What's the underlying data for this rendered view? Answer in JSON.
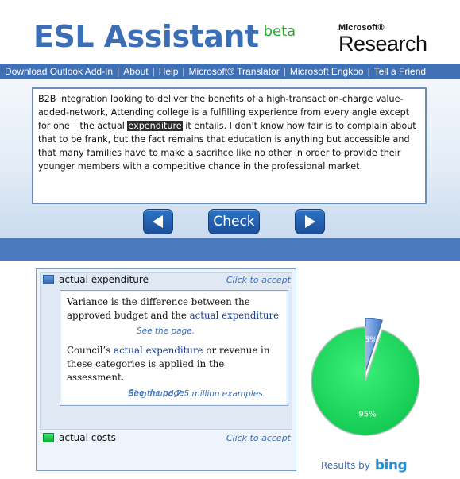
{
  "header": {
    "logo_main": "ESL Assistant",
    "logo_beta": "beta",
    "ms_small": "Microsoft®",
    "ms_big": "Research"
  },
  "nav": {
    "items": [
      "Download Outlook Add-In",
      "About",
      "Help",
      "Microsoft® Translator",
      "Microsoft Engkoo",
      "Tell a Friend"
    ],
    "separator": "|"
  },
  "editor": {
    "text_before": "B2B integration looking to deliver the benefits of a high-transaction-charge value-added-network, Attending college is a fulfilling experience from every angle except for one – the actual ",
    "highlighted": "expenditure",
    "text_after": " it entails. I don't know how fair is to complain about that to be frank, but the fact remains that education is anything but accessible and that many families have to make a sacrifice like no other in order to provide their younger members with a competitive chance in the professional market."
  },
  "controls": {
    "prev_icon": "left-arrow-icon",
    "check_label": "Check",
    "next_icon": "right-arrow-icon"
  },
  "suggestions": [
    {
      "label": "actual expenditure",
      "accept": "Click to accept",
      "color": "#2e64b0"
    },
    {
      "label": "actual costs",
      "accept": "Click to accept",
      "color": "#10b03a"
    }
  ],
  "examples": {
    "ex1_before": "Variance is the difference between the approved budget and the ",
    "ex1_link": "actual expenditure",
    "ex1_see": "See the page.",
    "ex2_before": "Council’s ",
    "ex2_link": "actual expenditure",
    "ex2_after": " or revenue in these categories is  applied in the assessment.",
    "ex2_see": "See the page.",
    "bing_found": "Bing found 7.5 million examples."
  },
  "chart_data": {
    "type": "pie",
    "categories": [
      "actual expenditure",
      "actual costs"
    ],
    "values": [
      5,
      95
    ],
    "labels": [
      "5%",
      "95%"
    ],
    "colors": [
      "#5f8fd6",
      "#13d860"
    ]
  },
  "footer": {
    "results_by": "Results by",
    "bing": "bing"
  }
}
